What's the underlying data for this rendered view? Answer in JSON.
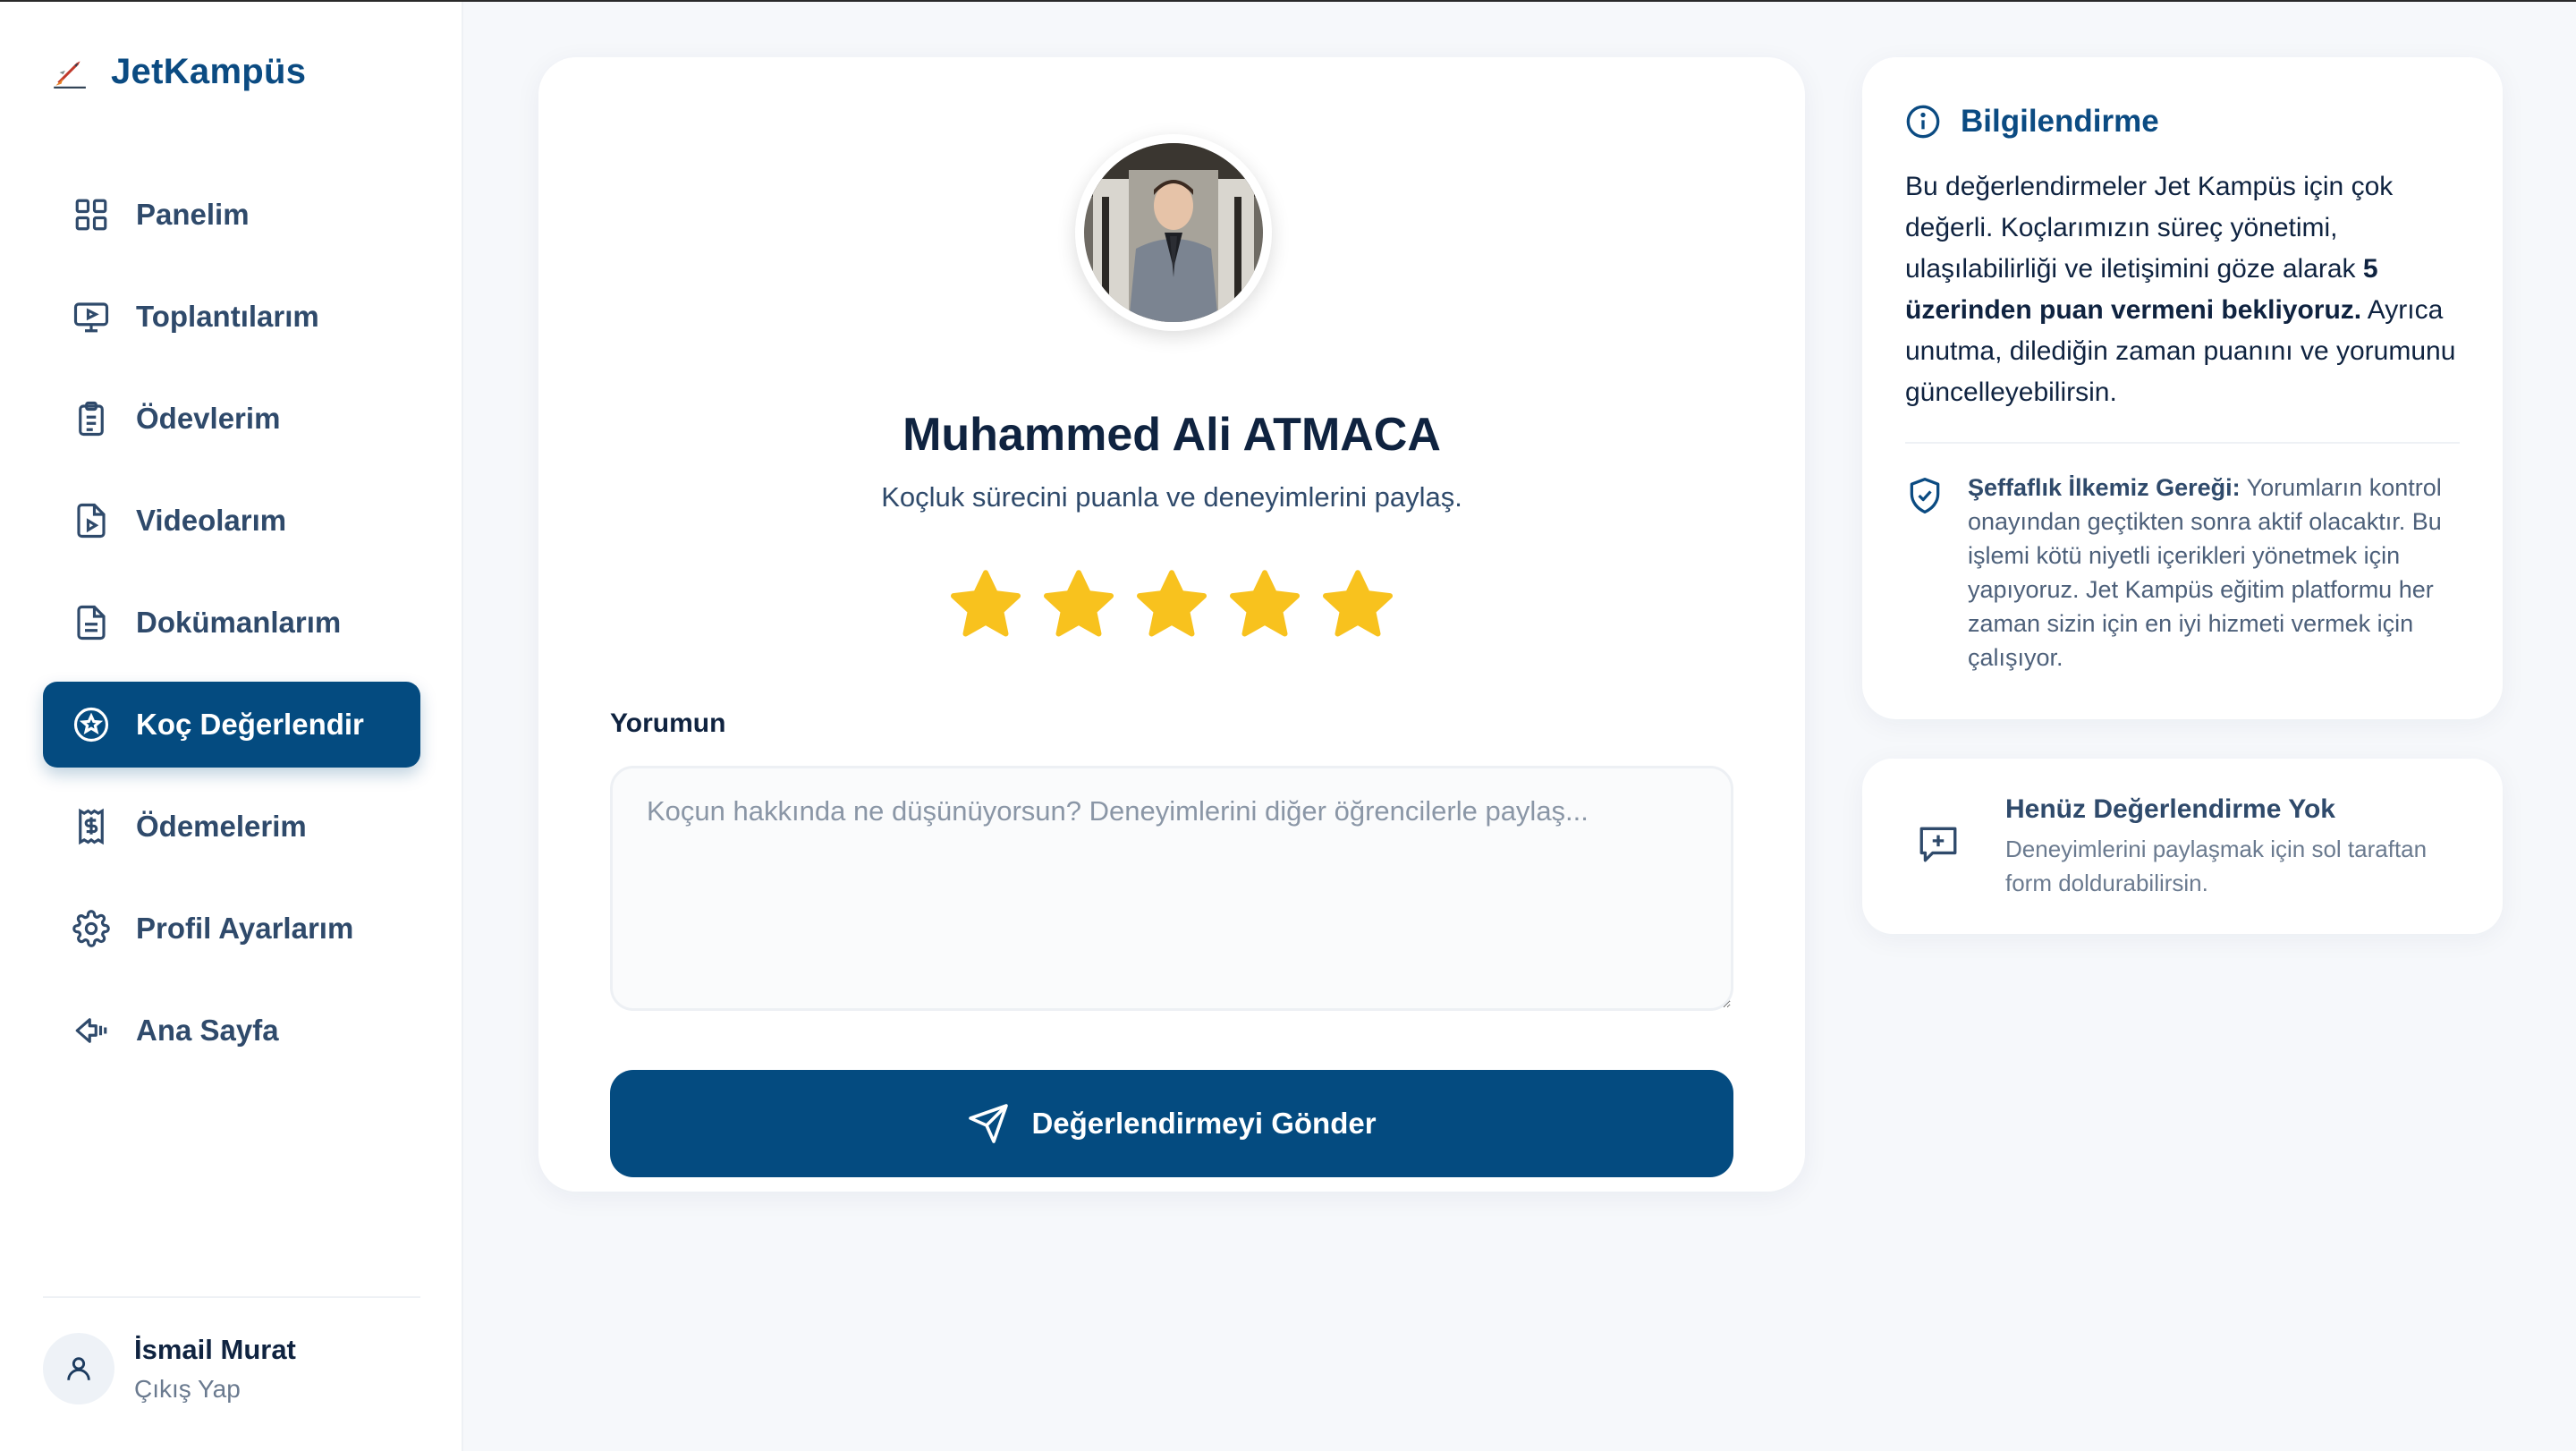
{
  "brand": {
    "name": "JetKampüs",
    "icon": "rocket-icon"
  },
  "sidebar": {
    "items": [
      {
        "label": "Panelim",
        "icon": "grid-icon"
      },
      {
        "label": "Toplantılarım",
        "icon": "monitor-play-icon"
      },
      {
        "label": "Ödevlerim",
        "icon": "clipboard-icon"
      },
      {
        "label": "Videolarım",
        "icon": "video-file-icon"
      },
      {
        "label": "Dokümanlarım",
        "icon": "document-icon"
      },
      {
        "label": "Koç Değerlendir",
        "icon": "star-badge-icon",
        "active": true
      },
      {
        "label": "Ödemelerim",
        "icon": "dollar-receipt-icon"
      },
      {
        "label": "Profil Ayarlarım",
        "icon": "gear-icon"
      },
      {
        "label": "Ana Sayfa",
        "icon": "arrow-left-icon"
      }
    ],
    "user": {
      "name": "İsmail Murat",
      "logout": "Çıkış Yap"
    }
  },
  "main": {
    "coach_name": "Muhammed Ali ATMACA",
    "subtitle": "Koçluk sürecini puanla ve deneyimlerini paylaş.",
    "rating": 5,
    "rating_max": 5,
    "star_color": "#f8c21e",
    "comment_label": "Yorumun",
    "comment_placeholder": "Koçun hakkında ne düşünüyorsun? Deneyimlerini diğer öğrencilerle paylaş...",
    "comment_value": "",
    "submit_label": "Değerlendirmeyi Gönder"
  },
  "info": {
    "title": "Bilgilendirme",
    "text_1": "Bu değerlendirmeler Jet Kampüs için çok değerli. Koçlarımızın süreç yönetimi, ulaşılabilirliği ve iletişimini göze alarak ",
    "text_bold": "5 üzerinden puan vermeni bekliyoruz.",
    "text_2": " Ayrıca unutma, dilediğin zaman puanını ve yorumunu güncelleyebilirsin.",
    "policy_title": "Şeffaflık İlkemiz Gereği:",
    "policy_text": " Yorumların kontrol onayından geçtikten sonra aktif olacaktır. Bu işlemi kötü niyetli içerikleri yönetmek için yapıyoruz. Jet Kampüs eğitim platformu her zaman sizin için en iyi hizmeti vermek için çalışıyor."
  },
  "empty": {
    "title": "Henüz Değerlendirme Yok",
    "text": "Deneyimlerini paylaşmak için sol taraftan form doldurabilirsin."
  },
  "colors": {
    "primary": "#044b80",
    "brand": "#0b4b82",
    "background": "#f6f8fb"
  }
}
